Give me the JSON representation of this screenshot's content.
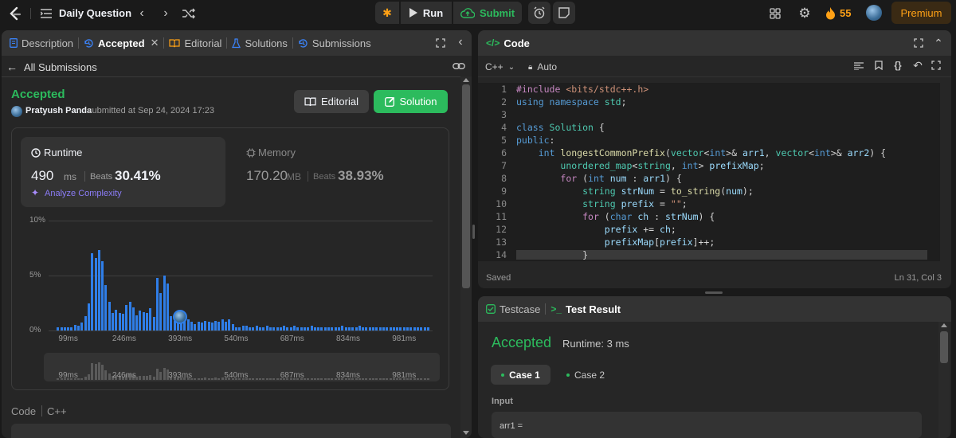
{
  "topbar": {
    "title": "Daily Question",
    "run_label": "Run",
    "submit_label": "Submit",
    "streak": "55",
    "premium_label": "Premium"
  },
  "left": {
    "tabs": [
      {
        "label": "Description"
      },
      {
        "label": "Accepted"
      },
      {
        "label": "Editorial"
      },
      {
        "label": "Solutions"
      },
      {
        "label": "Submissions"
      }
    ],
    "back_label": "All Submissions",
    "status": "Accepted",
    "user": "Pratyush Panda",
    "submitted": "submitted at Sep 24, 2024 17:23",
    "editorial_btn": "Editorial",
    "solution_btn": "Solution",
    "runtime": {
      "label": "Runtime",
      "value": "490",
      "unit": "ms",
      "beats_label": "Beats",
      "beats": "30.41%",
      "analyze": "Analyze Complexity"
    },
    "memory": {
      "label": "Memory",
      "value": "170.20",
      "unit": "MB",
      "beats_label": "Beats",
      "beats": "38.93%"
    },
    "code_label": "Code",
    "lang_label": "C++"
  },
  "chart_data": {
    "type": "bar",
    "y_ticks": [
      "10%",
      "5%",
      "0%"
    ],
    "ylim": [
      0,
      10
    ],
    "x_ticks": [
      "99ms",
      "246ms",
      "393ms",
      "540ms",
      "687ms",
      "834ms",
      "981ms"
    ],
    "x_tick_values": [
      99,
      246,
      393,
      540,
      687,
      834,
      981
    ],
    "xlim": [
      60,
      1060
    ],
    "x": [
      72,
      81,
      90,
      99,
      108,
      117,
      126,
      135,
      144,
      153,
      162,
      171,
      180,
      189,
      198,
      207,
      216,
      225,
      234,
      243,
      252,
      261,
      270,
      279,
      288,
      297,
      306,
      315,
      324,
      333,
      342,
      351,
      360,
      369,
      378,
      387,
      396,
      405,
      414,
      423,
      432,
      441,
      450,
      459,
      468,
      477,
      486,
      495,
      504,
      513,
      522,
      531,
      540,
      549,
      558,
      567,
      576,
      585,
      594,
      603,
      612,
      621,
      630,
      639,
      648,
      657,
      666,
      675,
      684,
      693,
      702,
      711,
      720,
      729,
      738,
      747,
      756,
      765,
      774,
      783,
      792,
      801,
      810,
      819,
      828,
      837,
      846,
      855,
      864,
      873,
      882,
      891,
      900,
      909,
      918,
      927,
      936,
      945,
      954,
      963,
      972,
      981,
      990,
      999,
      1008,
      1017,
      1026,
      1035,
      1044
    ],
    "values": [
      0.3,
      0.3,
      0.3,
      0.3,
      0.3,
      0.5,
      0.4,
      0.7,
      1.3,
      2.5,
      7.0,
      6.6,
      7.3,
      6.3,
      4.1,
      2.6,
      1.6,
      1.9,
      1.6,
      1.5,
      2.3,
      2.6,
      2.1,
      1.4,
      1.8,
      1.7,
      1.6,
      2.0,
      1.2,
      4.8,
      3.4,
      5.0,
      4.3,
      1.3,
      0.9,
      1.1,
      1.1,
      0.9,
      1.0,
      0.8,
      0.6,
      0.8,
      0.7,
      0.9,
      0.8,
      0.7,
      0.9,
      0.8,
      1.0,
      0.8,
      1.0,
      0.6,
      0.3,
      0.3,
      0.4,
      0.4,
      0.3,
      0.3,
      0.4,
      0.3,
      0.3,
      0.4,
      0.3,
      0.3,
      0.3,
      0.3,
      0.4,
      0.3,
      0.3,
      0.4,
      0.3,
      0.3,
      0.3,
      0.3,
      0.4,
      0.3,
      0.3,
      0.3,
      0.3,
      0.3,
      0.3,
      0.3,
      0.3,
      0.4,
      0.3,
      0.3,
      0.3,
      0.3,
      0.4,
      0.3,
      0.3,
      0.3,
      0.3,
      0.3,
      0.3,
      0.3,
      0.3,
      0.3,
      0.3,
      0.3,
      0.3,
      0.3,
      0.3,
      0.3,
      0.3,
      0.3,
      0.3,
      0.3,
      0.3
    ],
    "highlight_x": 396,
    "grid": true
  },
  "code": {
    "title": "Code",
    "lang": "C++",
    "mode": "Auto",
    "saved": "Saved",
    "cursor": "Ln 31, Col 3",
    "line_numbers": [
      "1",
      "2",
      "3",
      "4",
      "5",
      "6",
      "7",
      "8",
      "9",
      "10",
      "11",
      "12",
      "13",
      "14"
    ],
    "lines": [
      [
        [
          "p",
          "#include "
        ],
        [
          "s",
          "<bits/stdc++.h>"
        ]
      ],
      [
        [
          "k",
          "using namespace "
        ],
        [
          "t",
          "std"
        ],
        [
          "w",
          ";"
        ]
      ],
      [
        [
          "w",
          ""
        ]
      ],
      [
        [
          "k",
          "class "
        ],
        [
          "t",
          "Solution"
        ],
        [
          "w",
          " {"
        ]
      ],
      [
        [
          "k",
          "public"
        ],
        [
          "w",
          ":"
        ]
      ],
      [
        [
          "w",
          "    "
        ],
        [
          "k",
          "int "
        ],
        [
          "f",
          "longestCommonPrefix"
        ],
        [
          "w",
          "("
        ],
        [
          "t",
          "vector"
        ],
        [
          "w",
          "<"
        ],
        [
          "k",
          "int"
        ],
        [
          "w",
          ">& "
        ],
        [
          "v",
          "arr1"
        ],
        [
          "w",
          ", "
        ],
        [
          "t",
          "vector"
        ],
        [
          "w",
          "<"
        ],
        [
          "k",
          "int"
        ],
        [
          "w",
          ">& "
        ],
        [
          "v",
          "arr2"
        ],
        [
          "w",
          ") {"
        ]
      ],
      [
        [
          "w",
          "        "
        ],
        [
          "t",
          "unordered_map"
        ],
        [
          "w",
          "<"
        ],
        [
          "t",
          "string"
        ],
        [
          "w",
          ", "
        ],
        [
          "k",
          "int"
        ],
        [
          "w",
          "> "
        ],
        [
          "v",
          "prefixMap"
        ],
        [
          "w",
          ";"
        ]
      ],
      [
        [
          "w",
          "        "
        ],
        [
          "p",
          "for "
        ],
        [
          "w",
          "("
        ],
        [
          "k",
          "int "
        ],
        [
          "v",
          "num"
        ],
        [
          "w",
          " : "
        ],
        [
          "v",
          "arr1"
        ],
        [
          "w",
          ") {"
        ]
      ],
      [
        [
          "w",
          "            "
        ],
        [
          "t",
          "string "
        ],
        [
          "v",
          "strNum"
        ],
        [
          "w",
          " = "
        ],
        [
          "f",
          "to_string"
        ],
        [
          "w",
          "("
        ],
        [
          "v",
          "num"
        ],
        [
          "w",
          ");"
        ]
      ],
      [
        [
          "w",
          "            "
        ],
        [
          "t",
          "string "
        ],
        [
          "v",
          "prefix"
        ],
        [
          "w",
          " = "
        ],
        [
          "s",
          "\"\""
        ],
        [
          "w",
          ";"
        ]
      ],
      [
        [
          "w",
          "            "
        ],
        [
          "p",
          "for "
        ],
        [
          "w",
          "("
        ],
        [
          "k",
          "char "
        ],
        [
          "v",
          "ch"
        ],
        [
          "w",
          " : "
        ],
        [
          "v",
          "strNum"
        ],
        [
          "w",
          ") {"
        ]
      ],
      [
        [
          "w",
          "                "
        ],
        [
          "v",
          "prefix"
        ],
        [
          "w",
          " += "
        ],
        [
          "v",
          "ch"
        ],
        [
          "w",
          ";"
        ]
      ],
      [
        [
          "w",
          "                "
        ],
        [
          "v",
          "prefixMap"
        ],
        [
          "w",
          "["
        ],
        [
          "v",
          "prefix"
        ],
        [
          "w",
          "]++;"
        ]
      ],
      [
        [
          "w",
          "            }"
        ]
      ]
    ]
  },
  "test": {
    "testcase_tab": "Testcase",
    "result_tab": "Test Result",
    "status": "Accepted",
    "runtime": "Runtime: 3 ms",
    "case1": "Case 1",
    "case2": "Case 2",
    "input_label": "Input",
    "input_value": "arr1 ="
  },
  "colors": {
    "accent_green": "#2cbb5d",
    "chart_blue": "#2f7ee8",
    "premium": "#ffa116",
    "bg": "#1a1a1a",
    "panel": "#262626"
  }
}
